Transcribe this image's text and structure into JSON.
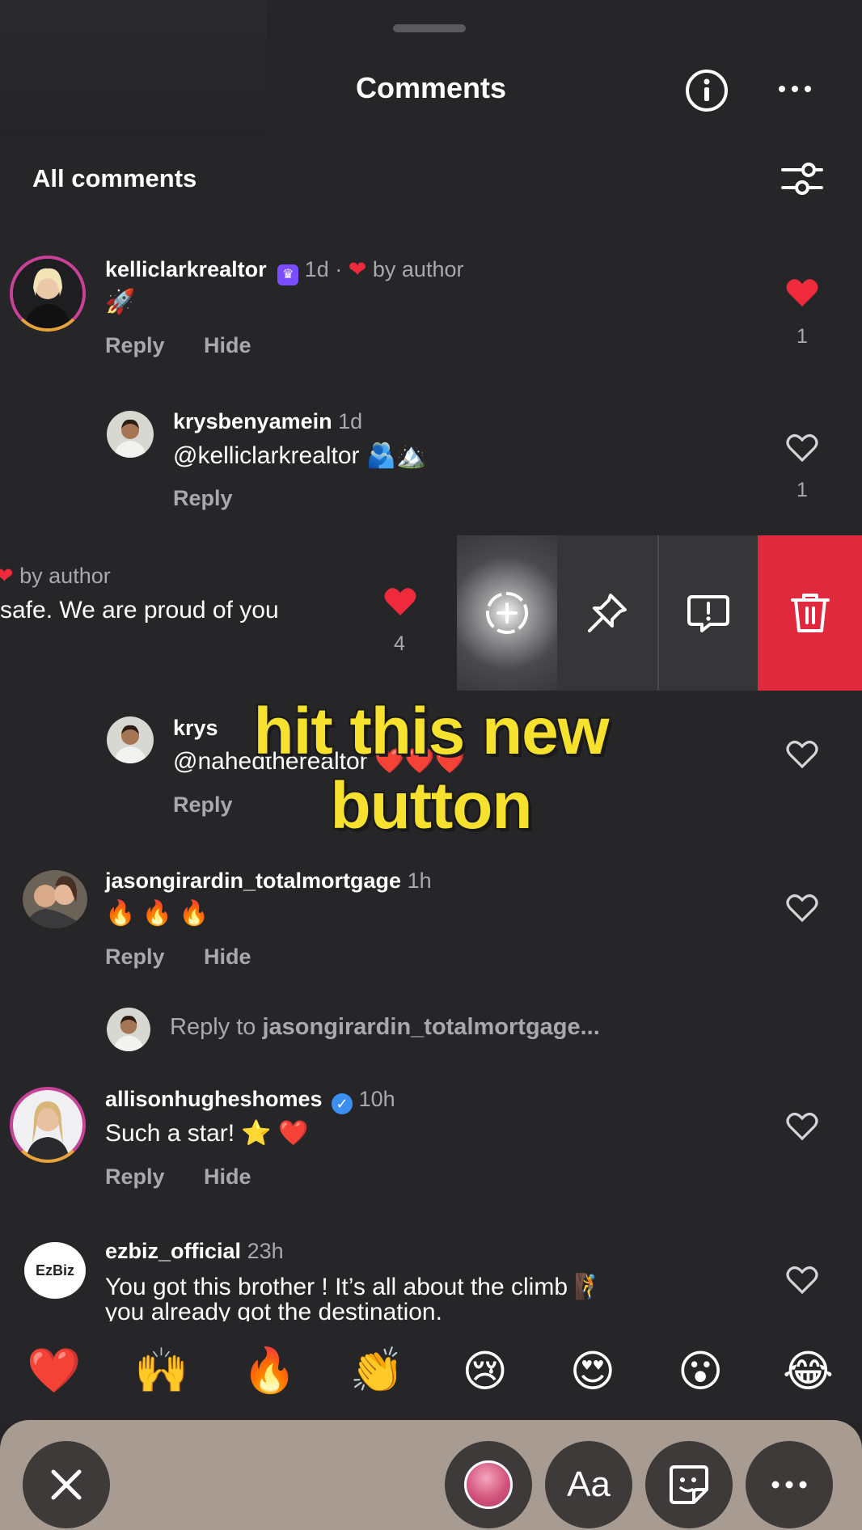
{
  "header": {
    "title": "Comments",
    "section_label": "All comments"
  },
  "comments": [
    {
      "username": "kelliclarkrealtor",
      "time": "1d",
      "liked_by": "by author",
      "separator": "·",
      "text": "🚀",
      "actions": [
        "Reply",
        "Hide"
      ],
      "like_count": "1"
    },
    {
      "username": "krysbenyamein",
      "time": "1d",
      "text": "@kelliclarkrealtor 🫂🏔️",
      "actions": [
        "Reply"
      ],
      "like_count": "1"
    },
    {
      "liked_by": "by author",
      "text": "safe. We are proud of you",
      "like_count": "4"
    },
    {
      "username": "krys",
      "text": "@nahedtherealtor ❤️❤️❤️",
      "actions": [
        "Reply"
      ]
    },
    {
      "username": "jasongirardin_totalmortgage",
      "time": "1h",
      "text": "🔥 🔥 🔥",
      "actions": [
        "Reply",
        "Hide"
      ]
    },
    {
      "username": "allisonhugheshomes",
      "time": "10h",
      "text": "Such a star! ⭐️ ❤️",
      "actions": [
        "Reply",
        "Hide"
      ]
    },
    {
      "username": "ezbiz_official",
      "time": "23h",
      "text_line1": "You got this brother ! It’s all about the climb 🧗",
      "text_line2": "you already got the destination.",
      "avatar_text": "EzBiz"
    }
  ],
  "reply_prompt": {
    "prefix": "Reply to ",
    "target": "jasongirardin_totalmortgage..."
  },
  "overlay": {
    "line1": "hit this new",
    "line2": "button"
  },
  "emoji_bar": [
    "❤️",
    "🙌",
    "🔥",
    "👏",
    "😢",
    "😍",
    "😮",
    "😂"
  ],
  "bottom_bar": {
    "text_tool": "Aa"
  },
  "colors": {
    "background": "#262628",
    "delete": "#e0293d",
    "overlay_text": "#f7e12f",
    "heart": "#ef2a3d"
  }
}
